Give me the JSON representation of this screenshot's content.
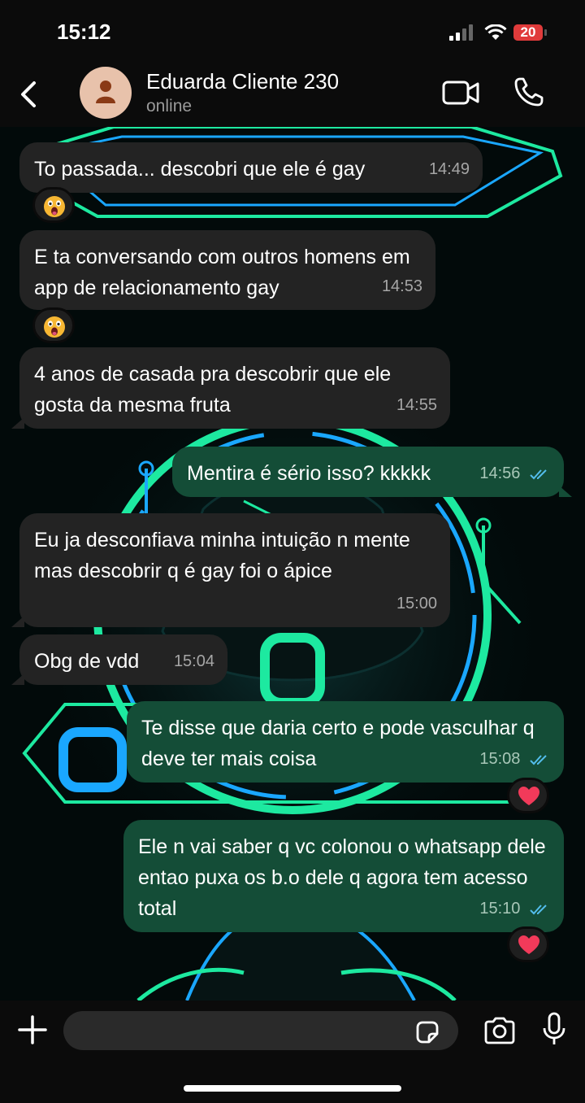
{
  "status_bar": {
    "time": "15:12",
    "battery": "20"
  },
  "header": {
    "contact_name": "Eduarda Cliente 230",
    "status": "online"
  },
  "messages": [
    {
      "direction": "in",
      "text": "To passada... descobri que ele é gay",
      "time": "14:49",
      "reaction": "shocked-face"
    },
    {
      "direction": "in",
      "text": "E ta conversando com outros homens em app de relacionamento gay",
      "time": "14:53",
      "reaction": "shocked-face"
    },
    {
      "direction": "in",
      "text": "4 anos de casada pra descobrir que ele gosta da mesma fruta",
      "time": "14:55"
    },
    {
      "direction": "out",
      "text": "Mentira é sério isso? kkkkk",
      "time": "14:56",
      "read": true
    },
    {
      "direction": "in",
      "text": "Eu ja desconfiava minha intuição n mente mas descobrir q é gay foi o ápice",
      "time": "15:00"
    },
    {
      "direction": "in",
      "text": "Obg de vdd",
      "time": "15:04"
    },
    {
      "direction": "out",
      "text": "Te disse que daria certo e pode vasculhar q deve ter mais coisa",
      "time": "15:08",
      "read": true,
      "reaction": "red-heart"
    },
    {
      "direction": "out",
      "text": "Ele n vai saber q vc colonou o whatsapp dele entao puxa os b.o dele q agora tem acesso total",
      "time": "15:10",
      "read": true,
      "reaction": "red-heart"
    }
  ],
  "composer": {
    "placeholder": ""
  },
  "colors": {
    "incoming_bubble": "#232323",
    "outgoing_bubble": "#144d37",
    "read_ticks": "#53bdeb",
    "battery_low": "#e03b3b",
    "neon_green": "#1de9a0",
    "neon_blue": "#1aa7ff"
  }
}
